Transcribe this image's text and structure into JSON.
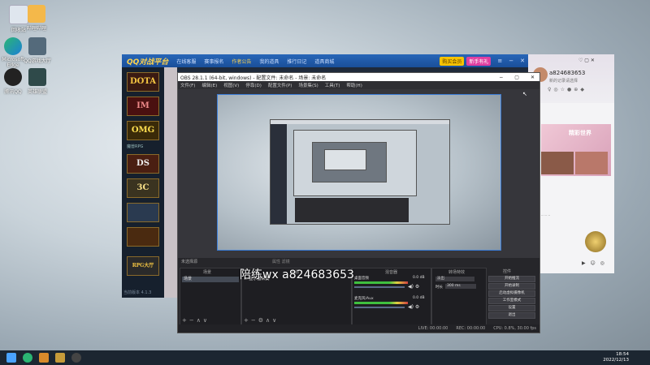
{
  "desktop": {
    "icons": [
      {
        "label": "回收站"
      },
      {
        "label": "哔哩哔哩"
      },
      {
        "label": "Microsoft Edge"
      },
      {
        "label": "QQ游戏大厅"
      },
      {
        "label": "腾讯QQ"
      },
      {
        "label": "英雄联盟"
      }
    ]
  },
  "qq_platform": {
    "logo": "QQ对战平台",
    "nav": [
      "在线客服",
      "赛事报名",
      "作者公告",
      "我的道具",
      "推行日记",
      "道具商城"
    ],
    "active_nav": "作者公告",
    "btn_vip": "购买会员",
    "btn_newbie": "新手有礼",
    "section_label": "魔兽RPG",
    "games": [
      "DOTA",
      "IM",
      "OMG",
      "DS",
      "3C",
      "RPG大厅"
    ],
    "version": "当前版本 4.1.3"
  },
  "chat": {
    "name": "a824683653",
    "sub": "新的记录请选择",
    "icons": [
      "♀",
      "◎",
      "☆",
      "●",
      "⊕",
      "◆"
    ],
    "banner": "精彩世界",
    "footer": "给你当导游"
  },
  "obs": {
    "title": "OBS 28.1.1 (64-bit, windows) - 配置文件: 未命名 - 场景: 未命名",
    "menu": [
      "文件(F)",
      "编辑(E)",
      "视图(V)",
      "停靠(D)",
      "配置文件(P)",
      "场景集(S)",
      "工具(T)",
      "帮助(H)"
    ],
    "panels": {
      "scenes": "场景",
      "sources": "来源",
      "mixer": "混音器",
      "transitions": "转场特效",
      "controls": "控件"
    },
    "scene_item": "场景",
    "source_item": "显示器采集",
    "no_source": "未选择源",
    "toolbar": [
      "属性",
      "滤镜"
    ],
    "mixer": [
      {
        "name": "桌面音频",
        "db": "0.0 dB"
      },
      {
        "name": "麦克风/Aux",
        "db": "0.0 dB"
      }
    ],
    "transition": {
      "type": "淡出",
      "duration_label": "时长",
      "duration": "300 ms"
    },
    "controls": [
      "开始推流",
      "开始录制",
      "启动虚拟摄像机",
      "工作室模式",
      "设置",
      "退出"
    ],
    "status": {
      "live": "LIVE: 00:00:00",
      "rec": "REC: 00:00:00",
      "cpu": "CPU: 0.8%, 30.00 fps"
    }
  },
  "watermark": "陪练wx  a824683653",
  "taskbar": {
    "time": "18:54",
    "date": "2022/12/13"
  }
}
